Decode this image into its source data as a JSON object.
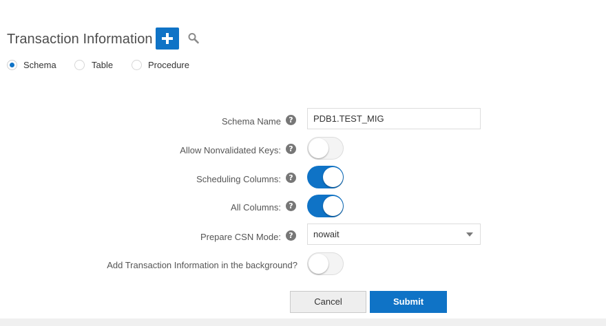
{
  "header": {
    "title": "Transaction Information",
    "add_icon": "plus-icon",
    "search_icon": "search-icon"
  },
  "radio_options": {
    "selected": "Schema",
    "options": [
      "Schema",
      "Table",
      "Procedure"
    ]
  },
  "form": {
    "schema_name": {
      "label": "Schema Name",
      "value": "PDB1.TEST_MIG"
    },
    "allow_nonvalidated_keys": {
      "label": "Allow Nonvalidated Keys:",
      "state": "off"
    },
    "scheduling_columns": {
      "label": "Scheduling Columns:",
      "state": "on"
    },
    "all_columns": {
      "label": "All Columns:",
      "state": "on"
    },
    "prepare_csn_mode": {
      "label": "Prepare CSN Mode:",
      "value": "nowait"
    },
    "add_in_background": {
      "label": "Add Transaction Information in the background?",
      "state": "off"
    },
    "help_glyph": "?"
  },
  "actions": {
    "cancel_label": "Cancel",
    "submit_label": "Submit"
  },
  "colors": {
    "accent": "#0f73c6",
    "help_icon": "#777777",
    "cancel_bg": "#eeeeee"
  }
}
